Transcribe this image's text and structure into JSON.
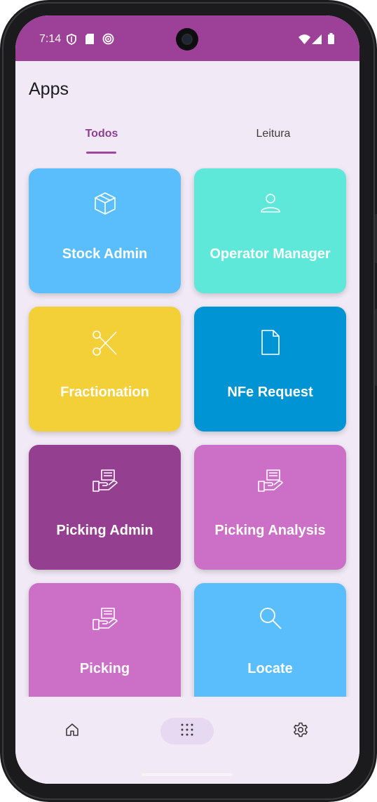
{
  "status_bar": {
    "time": "7:14",
    "color": "#9c4197"
  },
  "header": {
    "title": "Apps"
  },
  "tabs": [
    {
      "label": "Todos",
      "selected": true
    },
    {
      "label": "Leitura",
      "selected": false
    }
  ],
  "apps": [
    {
      "label": "Stock Admin",
      "icon": "box-icon",
      "color": "#5bbefc"
    },
    {
      "label": "Operator Manager",
      "icon": "person-icon",
      "color": "#5ee8d9"
    },
    {
      "label": "Fractionation",
      "icon": "scissors-icon",
      "color": "#f3cf38"
    },
    {
      "label": "NFe Request",
      "icon": "document-icon",
      "color": "#0094d4"
    },
    {
      "label": "Picking Admin",
      "icon": "picking-hand-icon",
      "color": "#953f91"
    },
    {
      "label": "Picking Analysis",
      "icon": "picking-hand-icon",
      "color": "#cb6fc7"
    },
    {
      "label": "Picking",
      "icon": "picking-hand-icon",
      "color": "#cb6fc7"
    },
    {
      "label": "Locate",
      "icon": "search-icon",
      "color": "#5bbefc"
    }
  ],
  "bottom_nav": [
    {
      "icon": "home-icon",
      "active": false
    },
    {
      "icon": "apps-grid-icon",
      "active": true
    },
    {
      "icon": "settings-icon",
      "active": false
    }
  ]
}
